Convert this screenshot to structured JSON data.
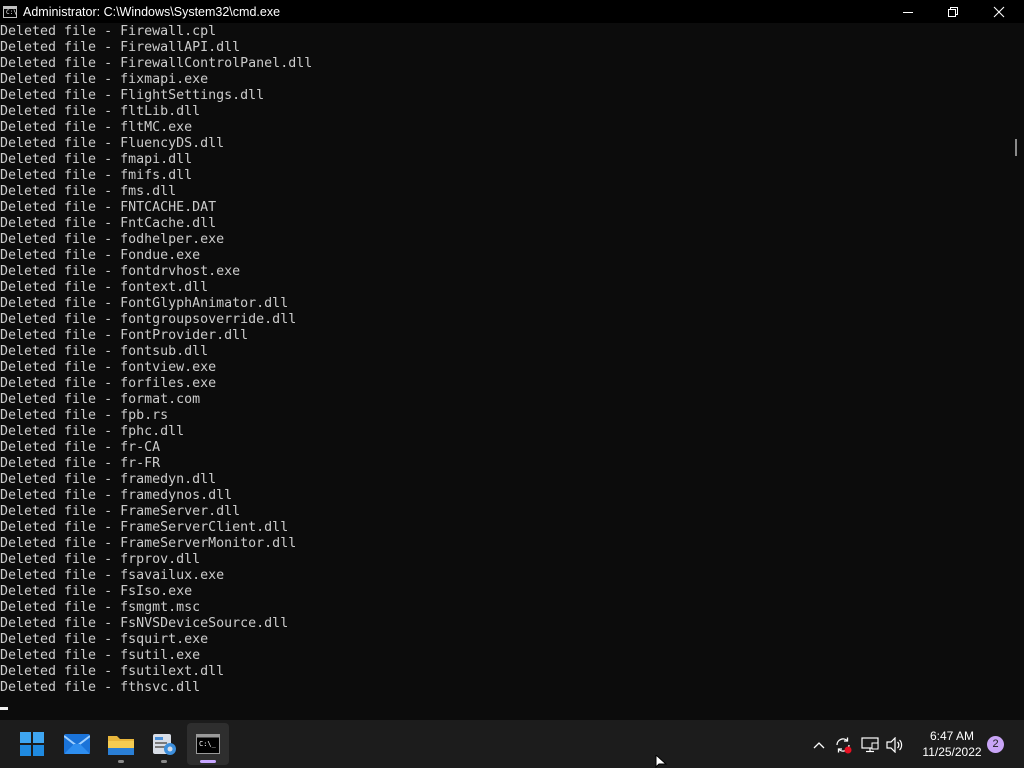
{
  "window": {
    "title": "Administrator:  C:\\Windows\\System32\\cmd.exe",
    "icon_glyph": "C:\\"
  },
  "console": {
    "lines": [
      "Deleted file - Firewall.cpl",
      "Deleted file - FirewallAPI.dll",
      "Deleted file - FirewallControlPanel.dll",
      "Deleted file - fixmapi.exe",
      "Deleted file - FlightSettings.dll",
      "Deleted file - fltLib.dll",
      "Deleted file - fltMC.exe",
      "Deleted file - FluencyDS.dll",
      "Deleted file - fmapi.dll",
      "Deleted file - fmifs.dll",
      "Deleted file - fms.dll",
      "Deleted file - FNTCACHE.DAT",
      "Deleted file - FntCache.dll",
      "Deleted file - fodhelper.exe",
      "Deleted file - Fondue.exe",
      "Deleted file - fontdrvhost.exe",
      "Deleted file - fontext.dll",
      "Deleted file - FontGlyphAnimator.dll",
      "Deleted file - fontgroupsoverride.dll",
      "Deleted file - FontProvider.dll",
      "Deleted file - fontsub.dll",
      "Deleted file - fontview.exe",
      "Deleted file - forfiles.exe",
      "Deleted file - format.com",
      "Deleted file - fpb.rs",
      "Deleted file - fphc.dll",
      "Deleted file - fr-CA",
      "Deleted file - fr-FR",
      "Deleted file - framedyn.dll",
      "Deleted file - framedynos.dll",
      "Deleted file - FrameServer.dll",
      "Deleted file - FrameServerClient.dll",
      "Deleted file - FrameServerMonitor.dll",
      "Deleted file - frprov.dll",
      "Deleted file - fsavailux.exe",
      "Deleted file - FsIso.exe",
      "Deleted file - fsmgmt.msc",
      "Deleted file - FsNVSDeviceSource.dll",
      "Deleted file - fsquirt.exe",
      "Deleted file - fsutil.exe",
      "Deleted file - fsutilext.dll",
      "Deleted file - fthsvc.dll"
    ]
  },
  "taskbar": {
    "apps": [
      {
        "name": "start-button",
        "icon": "windows-logo-icon",
        "active": false,
        "running": false
      },
      {
        "name": "mail",
        "icon": "mail-icon",
        "active": false,
        "running": false
      },
      {
        "name": "file-explorer",
        "icon": "folder-icon",
        "active": false,
        "running": true
      },
      {
        "name": "control-panel",
        "icon": "control-panel-icon",
        "active": false,
        "running": true
      },
      {
        "name": "command-prompt",
        "icon": "cmd-icon",
        "active": true,
        "running": true
      }
    ],
    "tray": {
      "clock_time": "6:47 AM",
      "clock_date": "11/25/2022",
      "notification_count": "2"
    }
  },
  "colors": {
    "console_bg": "#0c0c0c",
    "console_text": "#cccccc",
    "taskbar_bg": "#1c1c1c",
    "accent": "#c9a5f7"
  }
}
